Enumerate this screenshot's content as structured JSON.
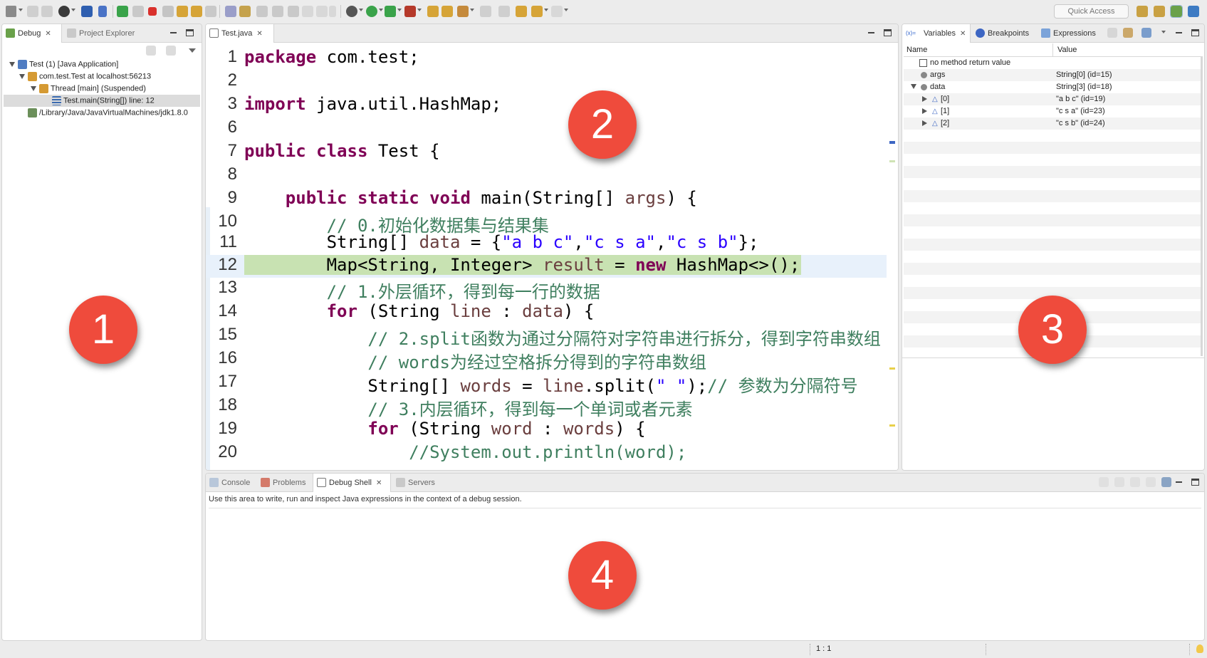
{
  "toolbar": {
    "quick_access_placeholder": "Quick Access"
  },
  "debug_view": {
    "tabs": [
      {
        "label": "Debug",
        "active": true
      },
      {
        "label": "Project Explorer",
        "active": false
      }
    ],
    "tree": [
      {
        "label": "Test (1) [Java Application]"
      },
      {
        "label": "com.test.Test at localhost:56213"
      },
      {
        "label": "Thread [main] (Suspended)"
      },
      {
        "label": "Test.main(String[]) line: 12",
        "selected": true
      },
      {
        "label": "/Library/Java/JavaVirtualMachines/jdk1.8.0"
      }
    ]
  },
  "editor": {
    "tab_label": "Test.java",
    "current_line": 12,
    "lines": [
      {
        "num": "1",
        "tokens": [
          {
            "t": "package",
            "c": "kw"
          },
          {
            "t": " com.test;",
            "c": "plain"
          }
        ]
      },
      {
        "num": "2",
        "tokens": []
      },
      {
        "num": "3",
        "tokens": [
          {
            "t": "import",
            "c": "kw"
          },
          {
            "t": " java.util.HashMap;",
            "c": "plain"
          }
        ]
      },
      {
        "num": "6",
        "tokens": []
      },
      {
        "num": "7",
        "tokens": [
          {
            "t": "public",
            "c": "kw"
          },
          {
            "t": " ",
            "c": "plain"
          },
          {
            "t": "class",
            "c": "kw"
          },
          {
            "t": " Test {",
            "c": "plain"
          }
        ]
      },
      {
        "num": "8",
        "tokens": []
      },
      {
        "num": "9",
        "tokens": [
          {
            "t": "    ",
            "c": "plain"
          },
          {
            "t": "public",
            "c": "kw"
          },
          {
            "t": " ",
            "c": "plain"
          },
          {
            "t": "static",
            "c": "kw"
          },
          {
            "t": " ",
            "c": "plain"
          },
          {
            "t": "void",
            "c": "kw"
          },
          {
            "t": " main(String[] ",
            "c": "plain"
          },
          {
            "t": "args",
            "c": "var"
          },
          {
            "t": ") {",
            "c": "plain"
          }
        ]
      },
      {
        "num": "10",
        "tokens": [
          {
            "t": "        // 0.初始化数据集与结果集",
            "c": "cmt"
          }
        ]
      },
      {
        "num": "11",
        "tokens": [
          {
            "t": "        String[] ",
            "c": "plain"
          },
          {
            "t": "data",
            "c": "var"
          },
          {
            "t": " = {",
            "c": "plain"
          },
          {
            "t": "\"a b c\"",
            "c": "str"
          },
          {
            "t": ",",
            "c": "plain"
          },
          {
            "t": "\"c s a\"",
            "c": "str"
          },
          {
            "t": ",",
            "c": "plain"
          },
          {
            "t": "\"c s b\"",
            "c": "str"
          },
          {
            "t": "};",
            "c": "plain"
          }
        ]
      },
      {
        "num": "12",
        "tokens": [
          {
            "t": "        Map<String, Integer> ",
            "c": "plain"
          },
          {
            "t": "result",
            "c": "var"
          },
          {
            "t": " = ",
            "c": "plain"
          },
          {
            "t": "new",
            "c": "kw"
          },
          {
            "t": " HashMap<>();",
            "c": "plain"
          }
        ]
      },
      {
        "num": "13",
        "tokens": [
          {
            "t": "        // 1.外层循环，得到每一行的数据",
            "c": "cmt"
          }
        ]
      },
      {
        "num": "14",
        "tokens": [
          {
            "t": "        ",
            "c": "plain"
          },
          {
            "t": "for",
            "c": "kw"
          },
          {
            "t": " (String ",
            "c": "plain"
          },
          {
            "t": "line",
            "c": "var"
          },
          {
            "t": " : ",
            "c": "plain"
          },
          {
            "t": "data",
            "c": "var"
          },
          {
            "t": ") {",
            "c": "plain"
          }
        ]
      },
      {
        "num": "15",
        "tokens": [
          {
            "t": "            // 2.split函数为通过分隔符对字符串进行拆分，得到字符串数组",
            "c": "cmt"
          }
        ]
      },
      {
        "num": "16",
        "tokens": [
          {
            "t": "            // words为经过空格拆分得到的字符串数组",
            "c": "cmt"
          }
        ]
      },
      {
        "num": "17",
        "tokens": [
          {
            "t": "            String[] ",
            "c": "plain"
          },
          {
            "t": "words",
            "c": "var"
          },
          {
            "t": " = ",
            "c": "plain"
          },
          {
            "t": "line",
            "c": "var"
          },
          {
            "t": ".split(",
            "c": "plain"
          },
          {
            "t": "\" \"",
            "c": "str"
          },
          {
            "t": ");",
            "c": "plain"
          },
          {
            "t": "// 参数为分隔符号",
            "c": "cmt"
          }
        ]
      },
      {
        "num": "18",
        "tokens": [
          {
            "t": "            // 3.内层循环，得到每一个单词或者元素",
            "c": "cmt"
          }
        ]
      },
      {
        "num": "19",
        "tokens": [
          {
            "t": "            ",
            "c": "plain"
          },
          {
            "t": "for",
            "c": "kw"
          },
          {
            "t": " (String ",
            "c": "plain"
          },
          {
            "t": "word",
            "c": "var"
          },
          {
            "t": " : ",
            "c": "plain"
          },
          {
            "t": "words",
            "c": "var"
          },
          {
            "t": ") {",
            "c": "plain"
          }
        ]
      },
      {
        "num": "20",
        "tokens": [
          {
            "t": "                //System.out.println(word);",
            "c": "cmt"
          }
        ]
      }
    ]
  },
  "variables_view": {
    "tabs": [
      {
        "label": "Variables",
        "active": true
      },
      {
        "label": "Breakpoints",
        "active": false
      },
      {
        "label": "Expressions",
        "active": false
      }
    ],
    "columns": [
      "Name",
      "Value"
    ],
    "rows": [
      {
        "name": "no method return value",
        "value": ""
      },
      {
        "name": "args",
        "value": "String[0]  (id=15)"
      },
      {
        "name": "data",
        "value": "String[3]  (id=18)"
      },
      {
        "name": "[0]",
        "value": "\"a b c\" (id=19)"
      },
      {
        "name": "[1]",
        "value": "\"c s a\" (id=23)"
      },
      {
        "name": "[2]",
        "value": "\"c s b\" (id=24)"
      }
    ]
  },
  "bottom_view": {
    "tabs": [
      {
        "label": "Console",
        "active": false
      },
      {
        "label": "Problems",
        "active": false
      },
      {
        "label": "Debug Shell",
        "active": true
      },
      {
        "label": "Servers",
        "active": false
      }
    ],
    "hint": "Use this area to write, run and inspect Java expressions in the context of a debug session."
  },
  "status_bar": {
    "position": "1 : 1"
  },
  "badges": [
    "1",
    "2",
    "3",
    "4"
  ]
}
